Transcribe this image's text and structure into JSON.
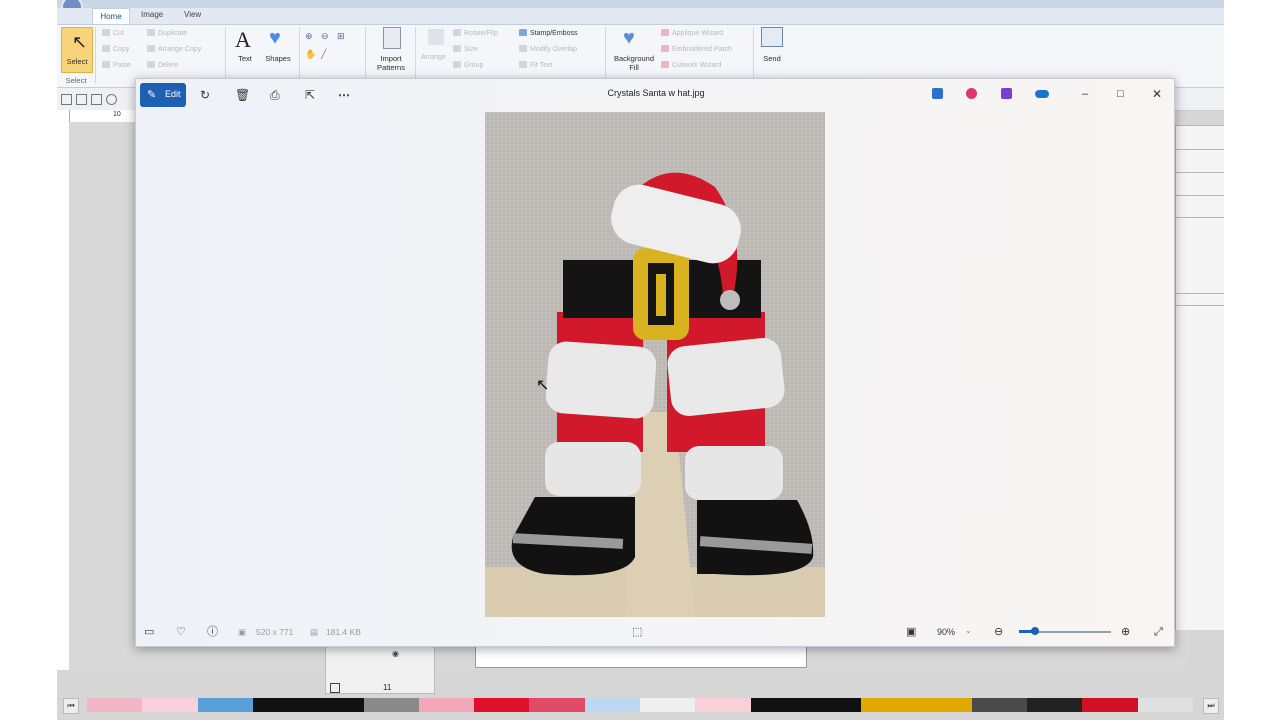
{
  "app": {
    "tabs": [
      "Home",
      "Image",
      "View"
    ],
    "ribbon": {
      "select_label": "Select",
      "select_group": "Select",
      "cut": "Cut",
      "copy": "Copy",
      "paste": "Paste",
      "duplicate": "Duplicate",
      "arrange_copy": "Arrange Copy",
      "delete": "Delete",
      "text": "Text",
      "shapes": "Shapes",
      "import_patterns": "Import Patterns",
      "arrange": "Arrange",
      "rotate_flip": "Rotate/Flip",
      "size": "Size",
      "group": "Group",
      "stamp_emboss": "Stamp/Emboss",
      "modify_overlap": "Modify Overlap",
      "fit_text": "Fit Text",
      "background_fill": "Background Fill",
      "applique_wizard": "Applique Wizard",
      "embroidered_patch": "Embroidered Patch",
      "cutwork_wizard": "Cutwork Wizard",
      "send": "Send"
    },
    "ruler_mark": "10",
    "panel_number": "11",
    "palette_colors": [
      "#f2b6c6",
      "#f6d0da",
      "#5aa0d8",
      "#111111",
      "#111111",
      "#8a8a8a",
      "#f2a8b8",
      "#e0102a",
      "#e34a66",
      "#bcd8f0",
      "#efefef",
      "#f7d0d8",
      "#111111",
      "#111111",
      "#e1a800",
      "#e1a800",
      "#4a4a4a",
      "#222222",
      "#d01024",
      "#e0e0e0"
    ]
  },
  "viewer": {
    "edit_label": "Edit",
    "file_name": "Crystals Santa w hat.jpg",
    "dimensions": "520 x 771",
    "file_size": "181.4 KB",
    "zoom": "90%",
    "zoom_level": 0.12
  },
  "colors": {
    "accent": "#1c5fb3",
    "santa_red": "#d2192b",
    "fur_white": "#eeeeee",
    "belt_black": "#141414",
    "buckle_gold": "#d8b21f"
  }
}
